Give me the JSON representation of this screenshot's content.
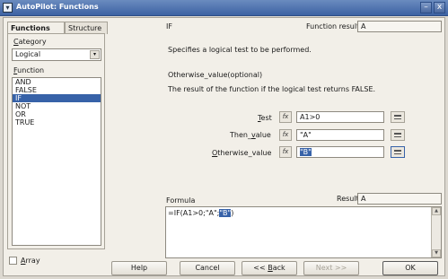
{
  "window": {
    "title": "AutoPilot: Functions",
    "minimize_glyph": "–",
    "close_glyph": "x"
  },
  "tabs": [
    {
      "label": "Functions"
    },
    {
      "label": "Structure"
    }
  ],
  "category": {
    "label": "Category",
    "label_ul": "C",
    "label_rest": "ategory",
    "selected": "Logical",
    "arrow": "▾"
  },
  "function_list": {
    "label_ul": "F",
    "label_rest": "unction",
    "items": [
      "AND",
      "FALSE",
      "IF",
      "NOT",
      "OR",
      "TRUE"
    ],
    "selected": "IF"
  },
  "function_info": {
    "name": "IF",
    "result_label": "Function result",
    "result_value": "A",
    "description": "Specifies a logical test to be performed.",
    "current_arg_title": "Otherwise_value(optional)",
    "current_arg_desc": "The result of the function if the logical test returns FALSE."
  },
  "arguments": [
    {
      "label_ul": "T",
      "label_rest": "est",
      "value": "A1>0",
      "fx": "fx"
    },
    {
      "label_pre": "Then_",
      "label_ul": "v",
      "label_rest": "alue",
      "value": "\"A\"",
      "fx": "fx"
    },
    {
      "label_ul": "O",
      "label_rest": "therwise_value",
      "value": "\"B\"",
      "fx": "fx"
    }
  ],
  "formula": {
    "label": "Formula",
    "result_label": "Result",
    "result_value": "A",
    "text_prefix": "=IF(A1>0;\"A\";",
    "text_selected": "\"B\"",
    "text_suffix": ")",
    "scroll_up": "▲",
    "scroll_down": "▼"
  },
  "footer": {
    "array_label": "Array",
    "array_ul": "A",
    "array_rest": "rray",
    "help": "Help",
    "cancel": "Cancel",
    "back": "<< Back",
    "back_pre": "<< ",
    "back_ul": "B",
    "back_rest": "ack",
    "next": "Next >>",
    "ok": "OK"
  }
}
